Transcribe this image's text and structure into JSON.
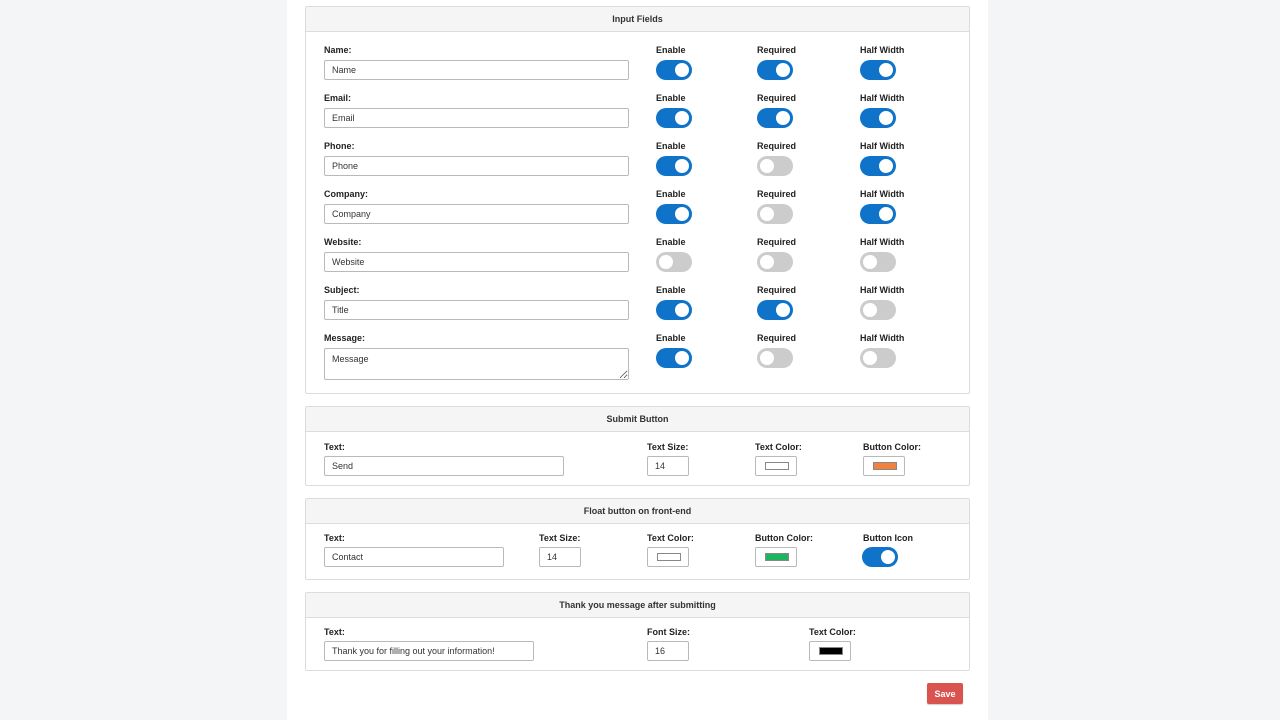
{
  "input_fields": {
    "title": "Input Fields",
    "col_enable": "Enable",
    "col_required": "Required",
    "col_half": "Half Width",
    "rows": [
      {
        "label": "Name:",
        "value": "Name",
        "enable": true,
        "required": true,
        "half": true
      },
      {
        "label": "Email:",
        "value": "Email",
        "enable": true,
        "required": true,
        "half": true
      },
      {
        "label": "Phone:",
        "value": "Phone",
        "enable": true,
        "required": false,
        "half": true
      },
      {
        "label": "Company:",
        "value": "Company",
        "enable": true,
        "required": false,
        "half": true
      },
      {
        "label": "Website:",
        "value": "Website",
        "enable": false,
        "required": false,
        "half": false
      },
      {
        "label": "Subject:",
        "value": "Title",
        "enable": true,
        "required": true,
        "half": false
      },
      {
        "label": "Message:",
        "value": "Message",
        "enable": true,
        "required": false,
        "half": false
      }
    ]
  },
  "submit_button": {
    "title": "Submit Button",
    "text_label": "Text:",
    "text_value": "Send",
    "size_label": "Text Size:",
    "size_value": "14",
    "text_color_label": "Text Color:",
    "text_color": "#ffffff",
    "button_color_label": "Button Color:",
    "button_color": "#f0813f"
  },
  "float_button": {
    "title": "Float button on front-end",
    "text_label": "Text:",
    "text_value": "Contact",
    "size_label": "Text Size:",
    "size_value": "14",
    "text_color_label": "Text Color:",
    "text_color": "#ffffff",
    "button_color_label": "Button Color:",
    "button_color": "#1db45e",
    "icon_label": "Button Icon",
    "icon_enabled": true
  },
  "thank_you": {
    "title": "Thank you message after submitting",
    "text_label": "Text:",
    "text_value": "Thank you for filling out your information!",
    "size_label": "Font Size:",
    "size_value": "16",
    "text_color_label": "Text Color:",
    "text_color": "#000000"
  },
  "save_label": "Save",
  "colors": {
    "toggle_on": "#0f73c9",
    "toggle_off": "#cccccc",
    "save": "#d9534f"
  }
}
